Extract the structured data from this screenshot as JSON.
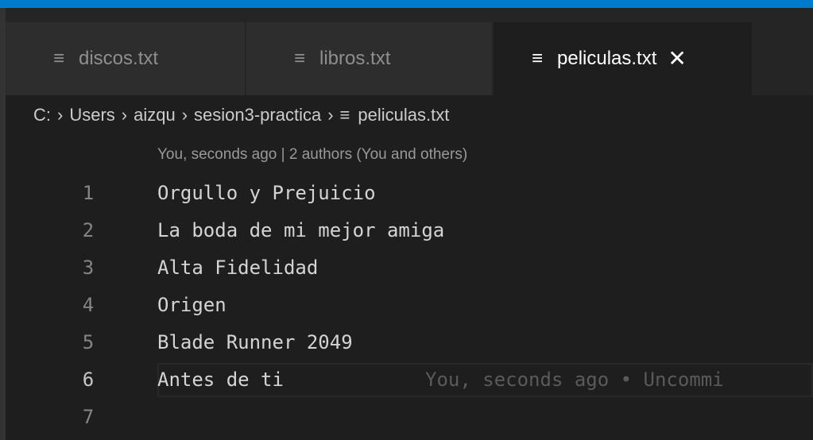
{
  "tabs": [
    {
      "label": "discos.txt",
      "icon": "≡",
      "active": false
    },
    {
      "label": "libros.txt",
      "icon": "≡",
      "active": false
    },
    {
      "label": "peliculas.txt",
      "icon": "≡",
      "active": true,
      "close": "✕"
    }
  ],
  "breadcrumb": {
    "drive": "C:",
    "separator": "›",
    "folder1": "Users",
    "folder2": "aizqu",
    "folder3": "sesion3-practica",
    "file_icon": "≡",
    "file": "peliculas.txt"
  },
  "codelens": "You, seconds ago | 2 authors (You and others)",
  "lines": [
    {
      "number": "1",
      "text": "Orgullo y Prejuicio"
    },
    {
      "number": "2",
      "text": "La boda de mi mejor amiga"
    },
    {
      "number": "3",
      "text": "Alta Fidelidad"
    },
    {
      "number": "4",
      "text": "Origen"
    },
    {
      "number": "5",
      "text": "Blade Runner 2049"
    },
    {
      "number": "6",
      "text": "Antes de ti",
      "blame": "You, seconds ago • Uncommi"
    },
    {
      "number": "7",
      "text": ""
    }
  ],
  "colors": {
    "editor_bg": "#1e1e1e",
    "tab_inactive": "#2d2d2d",
    "tab_active": "#1e1e1e",
    "accent": "#007acc"
  }
}
